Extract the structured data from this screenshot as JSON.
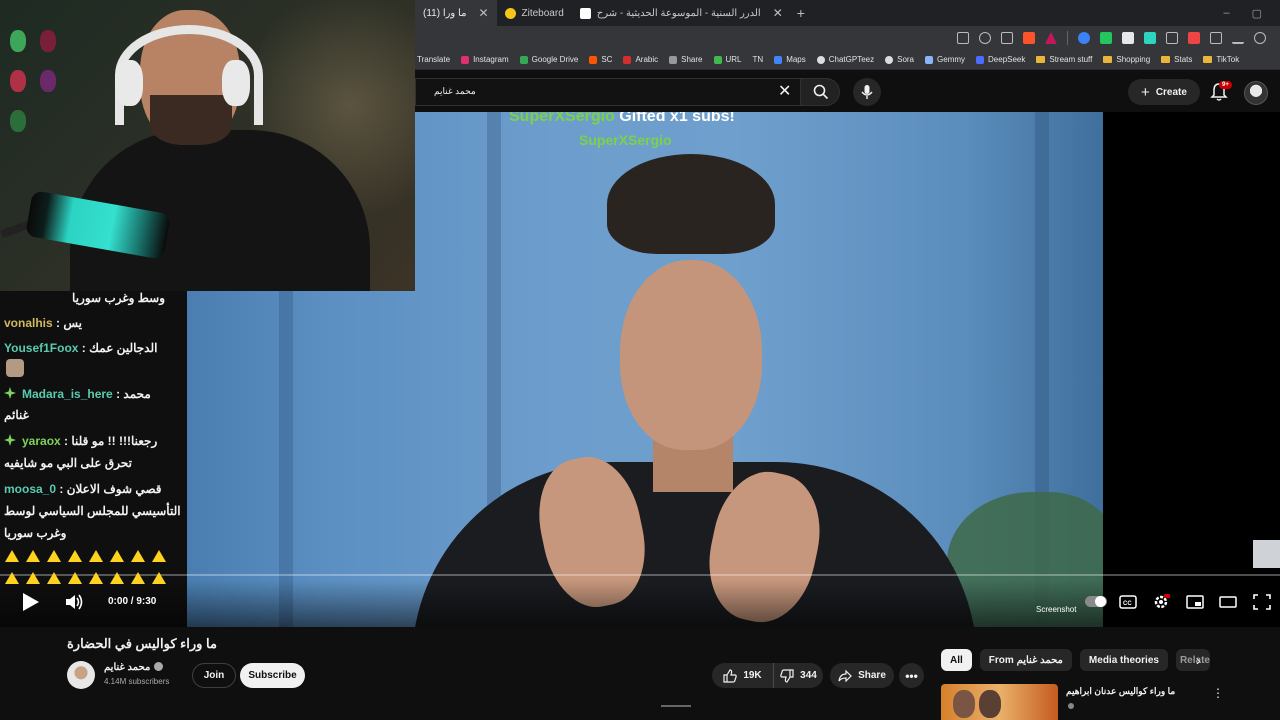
{
  "browser": {
    "tabs": [
      {
        "label": "(11) ما ورا",
        "active": true
      },
      {
        "label": "Ziteboard",
        "active": false
      },
      {
        "label": "الدرر السنية - الموسوعة الحديثية - شرح",
        "active": false
      }
    ],
    "new_tab": "+",
    "window_controls": [
      "–",
      "▢"
    ],
    "bookmarks": [
      "Translate",
      "Instagram",
      "Google Drive",
      "SC",
      "Arabic",
      "Share",
      "URL",
      "TN",
      "Maps",
      "ChatGPTeez",
      "Sora",
      "Gemmy",
      "DeepSeek",
      "Stream stuff",
      "Shopping",
      "Stats",
      "TikTok"
    ]
  },
  "youtube_header": {
    "search_value": "محمد غنايم",
    "create_label": "Create",
    "notification_count": "9+"
  },
  "stream_alert": {
    "user": "SuperXSergio",
    "text": " Gifted x1 subs!",
    "user_repeat": "SuperXSergio"
  },
  "chat": {
    "lines": [
      {
        "name": "",
        "msg": "وسط وغرب سوريا"
      },
      {
        "name": "vonalhis",
        "sep": " : ",
        "msg": "يس"
      },
      {
        "name": "Yousef1Foox",
        "sep": " : ",
        "msg": "الدجالين عمك"
      },
      {
        "name": "Madara_is_here",
        "sep": " : ",
        "msg": "محمد"
      },
      {
        "name": "",
        "msg": "غنائم"
      },
      {
        "name": "yaraox",
        "sep": " : ",
        "msg": "رجعنا!!! !! مو قلنا"
      },
      {
        "name": "",
        "msg": "تحرق على البي مو شايفيه"
      },
      {
        "name": "moosa_0",
        "sep": " : ",
        "msg": "قصي شوف الاعلان"
      },
      {
        "name": "",
        "msg": "التأسيسي للمجلس السياسي لوسط"
      },
      {
        "name": "",
        "msg": "وغرب سوريا"
      }
    ]
  },
  "player": {
    "time": "0:00 / 9:30",
    "screenshot_label": "Screenshot"
  },
  "video": {
    "title": "ما وراء كواليس في الحضارة",
    "channel": "محمد غنايم",
    "subscribers": "4.14M subscribers",
    "join_label": "Join",
    "subscribe_label": "Subscribe",
    "likes": "19K",
    "dislikes": "344",
    "share_label": "Share",
    "more": "•••"
  },
  "chips": [
    "All",
    "From محمد غنايم",
    "Media theories",
    "Relate"
  ],
  "recommendation": {
    "title": "ما وراء كواليس عدنان ابراهيم",
    "more": "⋮"
  },
  "colors": {
    "alert_green": "#7bd24a",
    "chat_gold": "#d1b85a",
    "chat_green": "#7dd45a",
    "chat_teal": "#59cbb0",
    "mic_cyan": "#35e0cf"
  }
}
